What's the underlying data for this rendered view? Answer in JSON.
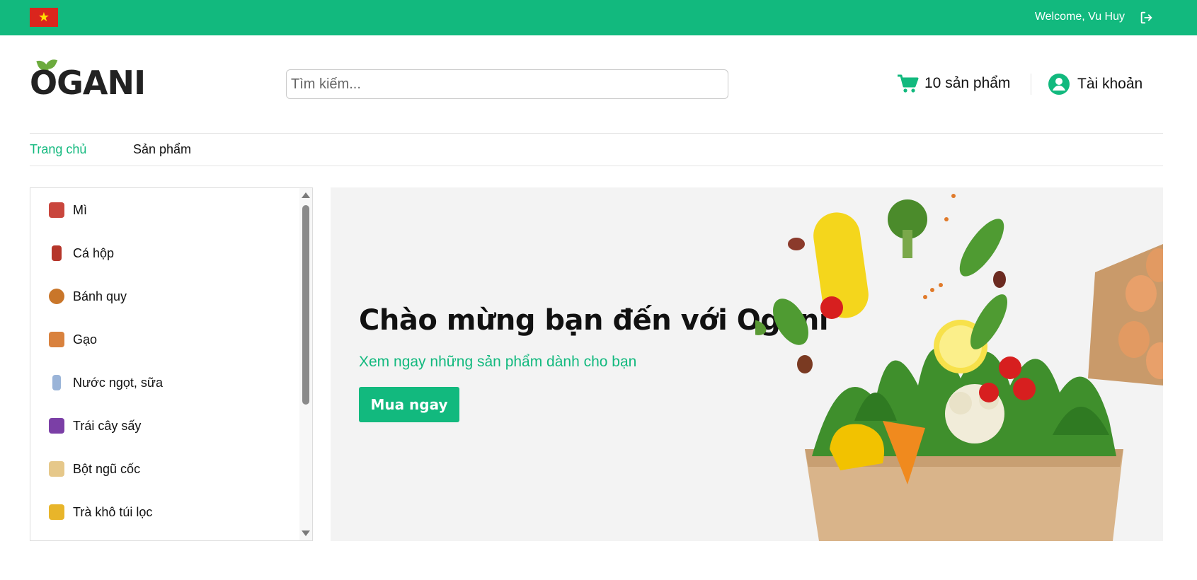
{
  "topbar": {
    "flag_symbol": "★",
    "welcome_text": "Welcome, Vu Huy",
    "logout_icon": "logout-icon",
    "background_color": "#12b97e"
  },
  "header": {
    "logo_text": "OGANI",
    "search_placeholder": "Tìm kiếm...",
    "cart_label": "10 sản phẩm",
    "cart_icon": "cart-icon",
    "account_label": "Tài khoản",
    "account_icon": "user-circle-icon"
  },
  "nav": {
    "items": [
      {
        "label": "Trang chủ",
        "active": true
      },
      {
        "label": "Sản phẩm",
        "active": false
      }
    ]
  },
  "sidebar": {
    "categories": [
      {
        "label": "Mì",
        "thumb_color": "#c9463d"
      },
      {
        "label": "Cá hộp",
        "thumb_color": "#b5352a"
      },
      {
        "label": "Bánh quy",
        "thumb_color": "#c9762a"
      },
      {
        "label": "Gạo",
        "thumb_color": "#d9823e"
      },
      {
        "label": "Nước ngọt, sữa",
        "thumb_color": "#9ab4d8"
      },
      {
        "label": "Trái cây sấy",
        "thumb_color": "#7b3fa6"
      },
      {
        "label": "Bột ngũ cốc",
        "thumb_color": "#e6c88a"
      },
      {
        "label": "Trà khô túi lọc",
        "thumb_color": "#e8b52a"
      }
    ]
  },
  "hero": {
    "title": "Chào mừng bạn đến với Ogani",
    "subtitle": "Xem ngay những sản phẩm dành cho bạn",
    "button_label": "Mua ngay"
  },
  "colors": {
    "accent": "#12b97e",
    "text": "#111111"
  }
}
